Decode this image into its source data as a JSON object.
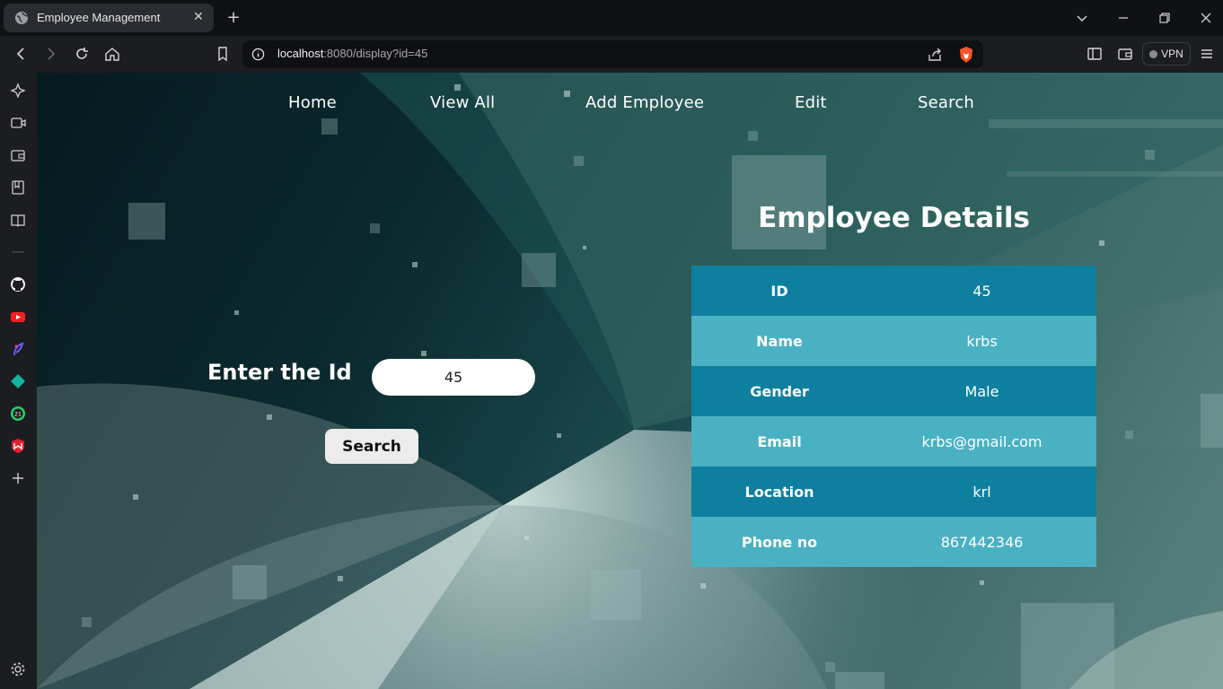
{
  "browser": {
    "tab_title": "Employee Management",
    "url_host": "localhost",
    "url_rest": ":8080/display?id=45",
    "vpn_label": "VPN"
  },
  "nav": {
    "home": "Home",
    "view_all": "View All",
    "add_employee": "Add Employee",
    "edit": "Edit",
    "search": "Search"
  },
  "search_form": {
    "label": "Enter the Id",
    "id_value": "45",
    "button_label": "Search"
  },
  "details": {
    "title": "Employee Details",
    "rows": [
      {
        "key": "ID",
        "value": "45"
      },
      {
        "key": "Name",
        "value": "krbs"
      },
      {
        "key": "Gender",
        "value": "Male"
      },
      {
        "key": "Email",
        "value": "krbs@gmail.com"
      },
      {
        "key": "Location",
        "value": "krl"
      },
      {
        "key": "Phone no",
        "value": "867442346"
      }
    ]
  },
  "colors": {
    "row_dark": "#0e7f9f",
    "row_light": "#4ab1c3",
    "brave_accent": "#fb542b"
  },
  "sidebar_icons": [
    "leo-ai-icon",
    "video-icon",
    "wallet-icon",
    "bookmarks-icon",
    "reading-list-icon",
    "github-icon",
    "youtube-icon",
    "feather-app-icon",
    "diamond-app-icon",
    "whatsapp-icon",
    "mcafee-icon",
    "add-panel-icon",
    "settings-icon"
  ]
}
